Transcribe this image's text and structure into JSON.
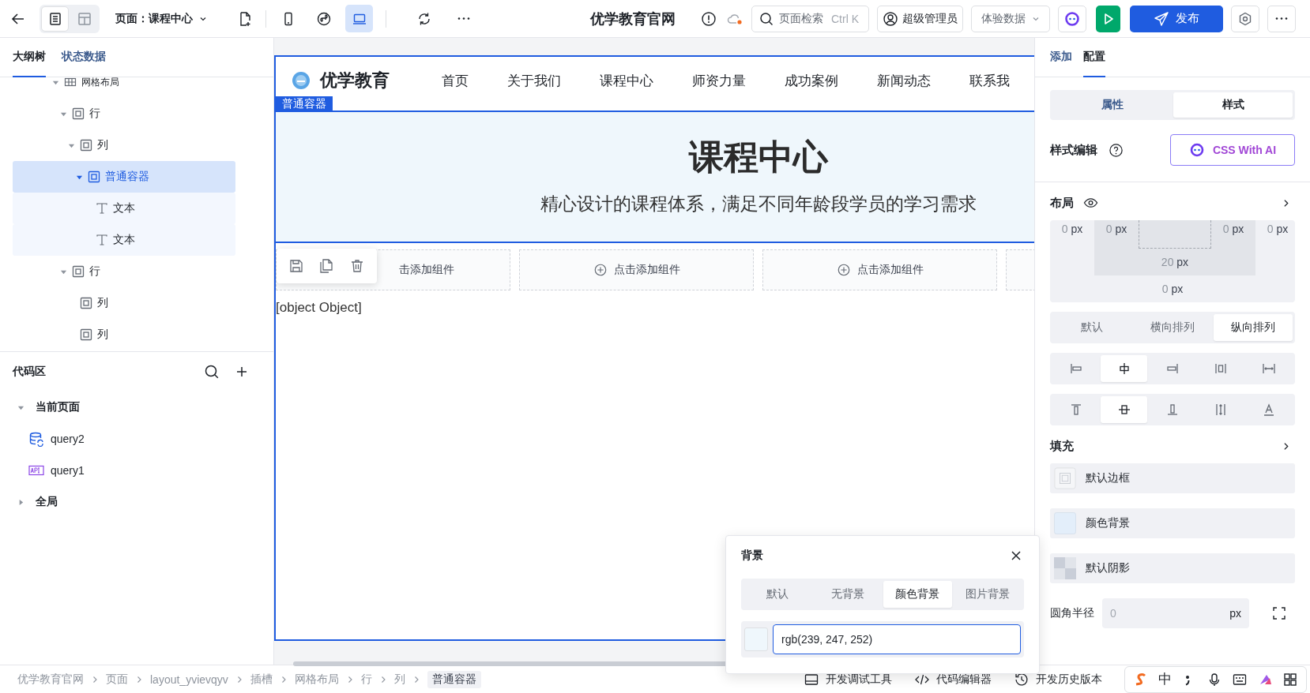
{
  "toolbar": {
    "panel_modes": [
      {
        "kind": "outline",
        "selected": true
      },
      {
        "kind": "layout",
        "selected": false
      }
    ],
    "page_label": "页面：课程中心",
    "view_modes": [
      {
        "kind": "mobile",
        "selected": false
      },
      {
        "kind": "miniprogram",
        "selected": false
      },
      {
        "kind": "desktop",
        "selected": true
      }
    ],
    "site_title": "优学教育官网",
    "search": {
      "placeholder": "页面检索",
      "shortcut": "Ctrl K"
    },
    "user": "超级管理员",
    "data_mode": "体验数据",
    "publish": "发布"
  },
  "left_panel": {
    "tabs": [
      {
        "label": "大纲树",
        "selected": true
      },
      {
        "label": "状态数据",
        "selected": false
      }
    ],
    "tree": [
      {
        "kind": "grid",
        "label": "网格布局",
        "expanded": true,
        "selected": false,
        "children": [
          {
            "kind": "container",
            "label": "行",
            "expanded": true,
            "selected": false,
            "children": [
              {
                "kind": "container",
                "label": "列",
                "expanded": true,
                "selected": false,
                "children": [
                  {
                    "kind": "container",
                    "label": "普通容器",
                    "expanded": true,
                    "selected": true,
                    "children": [
                      {
                        "kind": "text",
                        "label": "文本",
                        "selected": false
                      },
                      {
                        "kind": "text",
                        "label": "文本",
                        "selected": false
                      }
                    ]
                  }
                ]
              }
            ]
          },
          {
            "kind": "container",
            "label": "行",
            "expanded": true,
            "selected": false,
            "children": [
              {
                "kind": "container",
                "label": "列",
                "selected": false
              },
              {
                "kind": "container",
                "label": "列",
                "selected": false
              }
            ]
          }
        ]
      }
    ],
    "code_area": {
      "title": "代码区",
      "groups": [
        {
          "label": "当前页面",
          "expanded": true,
          "items": [
            {
              "kind": "database",
              "label": "query2"
            },
            {
              "kind": "api",
              "label": "query1"
            }
          ]
        },
        {
          "label": "全局",
          "expanded": false
        }
      ]
    }
  },
  "canvas": {
    "brand": "优学教育",
    "nav": [
      "首页",
      "关于我们",
      "课程中心",
      "师资力量",
      "成功案例",
      "新闻动态",
      "联系我"
    ],
    "selection_label": "普通容器",
    "hero": {
      "title": "课程中心",
      "subtitle": "精心设计的课程体系，满足不同年龄段学员的学习需求"
    },
    "slots": [
      {
        "kind": "add",
        "label": "击添加组件"
      },
      {
        "kind": "add",
        "label": "点击添加组件",
        "plus": true
      },
      {
        "kind": "add",
        "label": "点击添加组件",
        "plus": true
      },
      {
        "kind": "empty"
      }
    ],
    "stray_text": "[object Object]"
  },
  "right_panel": {
    "tabs": [
      {
        "label": "添加",
        "selected": false
      },
      {
        "label": "配置",
        "selected": true
      }
    ],
    "mode_tabs": [
      {
        "label": "属性",
        "selected": false
      },
      {
        "label": "样式",
        "selected": true
      }
    ],
    "style_edit": "样式编辑",
    "ai_button": "CSS With AI",
    "layout": {
      "title": "布局",
      "box_model": {
        "margin_left": {
          "value": "0",
          "unit": "px"
        },
        "padding_left": {
          "value": "0",
          "unit": "px"
        },
        "padding_right": {
          "value": "0",
          "unit": "px"
        },
        "margin_right": {
          "value": "0",
          "unit": "px"
        },
        "padding_bottom": {
          "value": "20",
          "unit": "px"
        },
        "margin_bottom": {
          "value": "0",
          "unit": "px"
        }
      },
      "direction": [
        {
          "label": "默认",
          "selected": false
        },
        {
          "label": "横向排列",
          "selected": false
        },
        {
          "label": "纵向排列",
          "selected": true
        }
      ],
      "align": [
        {
          "kind": "left",
          "selected": false
        },
        {
          "kind": "center",
          "selected": true
        },
        {
          "kind": "right",
          "selected": false
        },
        {
          "kind": "between",
          "selected": false
        },
        {
          "kind": "around",
          "selected": false
        }
      ],
      "valign": [
        {
          "kind": "top",
          "selected": false
        },
        {
          "kind": "middle",
          "selected": true
        },
        {
          "kind": "bottom",
          "selected": false
        },
        {
          "kind": "stretch",
          "selected": false
        },
        {
          "kind": "baseline",
          "selected": false
        }
      ]
    },
    "fill": {
      "title": "填充",
      "items": [
        {
          "kind": "border",
          "label": "默认边框"
        },
        {
          "kind": "color",
          "label": "颜色背景"
        },
        {
          "kind": "shadow",
          "label": "默认阴影"
        }
      ]
    },
    "radius": {
      "label": "圆角半径",
      "placeholder": "0",
      "unit": "px"
    }
  },
  "background_popup": {
    "title": "背景",
    "tabs": [
      {
        "label": "默认",
        "selected": false
      },
      {
        "label": "无背景",
        "selected": false
      },
      {
        "label": "颜色背景",
        "selected": true
      },
      {
        "label": "图片背景",
        "selected": false
      }
    ],
    "value": "rgb(239, 247, 252)"
  },
  "breadcrumb": [
    "优学教育官网",
    "页面",
    "layout_yvievqyv",
    "插槽",
    "网格布局",
    "行",
    "列",
    "普通容器"
  ],
  "dev_tools": [
    {
      "kind": "debug",
      "label": "开发调试工具"
    },
    {
      "kind": "code",
      "label": "代码编辑器"
    },
    {
      "kind": "history",
      "label": "开发历史版本"
    }
  ],
  "ime_toolbar": {
    "mode": "中"
  }
}
